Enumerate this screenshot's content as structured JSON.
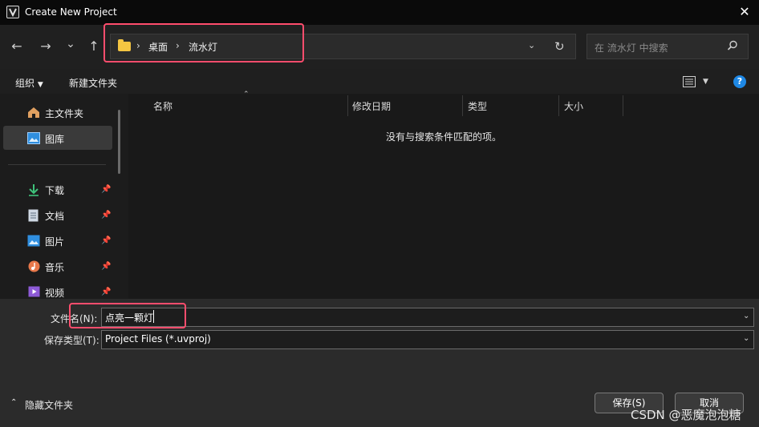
{
  "window": {
    "title": "Create New Project"
  },
  "nav": {
    "back": "←",
    "forward": "→",
    "recent": "⌄",
    "up": "↑",
    "breadcrumb": [
      "桌面",
      "流水灯"
    ],
    "search_placeholder": "在 流水灯 中搜索"
  },
  "toolbar": {
    "organize": "组织",
    "new_folder": "新建文件夹",
    "help": "?"
  },
  "sidebar": {
    "items": [
      {
        "label": "主文件夹",
        "icon": "home-icon"
      },
      {
        "label": "图库",
        "icon": "gallery-icon",
        "selected": true
      },
      {
        "label": "下载",
        "icon": "download-icon",
        "pinned": true
      },
      {
        "label": "文档",
        "icon": "document-icon",
        "pinned": true
      },
      {
        "label": "图片",
        "icon": "picture-icon",
        "pinned": true
      },
      {
        "label": "音乐",
        "icon": "music-icon",
        "pinned": true
      },
      {
        "label": "视频",
        "icon": "video-icon",
        "pinned": true
      }
    ]
  },
  "list": {
    "columns": [
      "名称",
      "修改日期",
      "类型",
      "大小"
    ],
    "empty_message": "没有与搜索条件匹配的项。"
  },
  "form": {
    "filename_label": "文件名(N):",
    "filename_value": "点亮一颗灯",
    "filetype_label": "保存类型(T):",
    "filetype_value": "Project Files (*.uvproj)"
  },
  "footer": {
    "hide_folders": "隐藏文件夹",
    "save": "保存(S)",
    "cancel": "取消"
  },
  "watermark": "CSDN @恶魔泡泡糖",
  "colors": {
    "highlight_box": "#ff4d6d",
    "help_blue": "#1e88e5",
    "folder": "#f4c542"
  }
}
